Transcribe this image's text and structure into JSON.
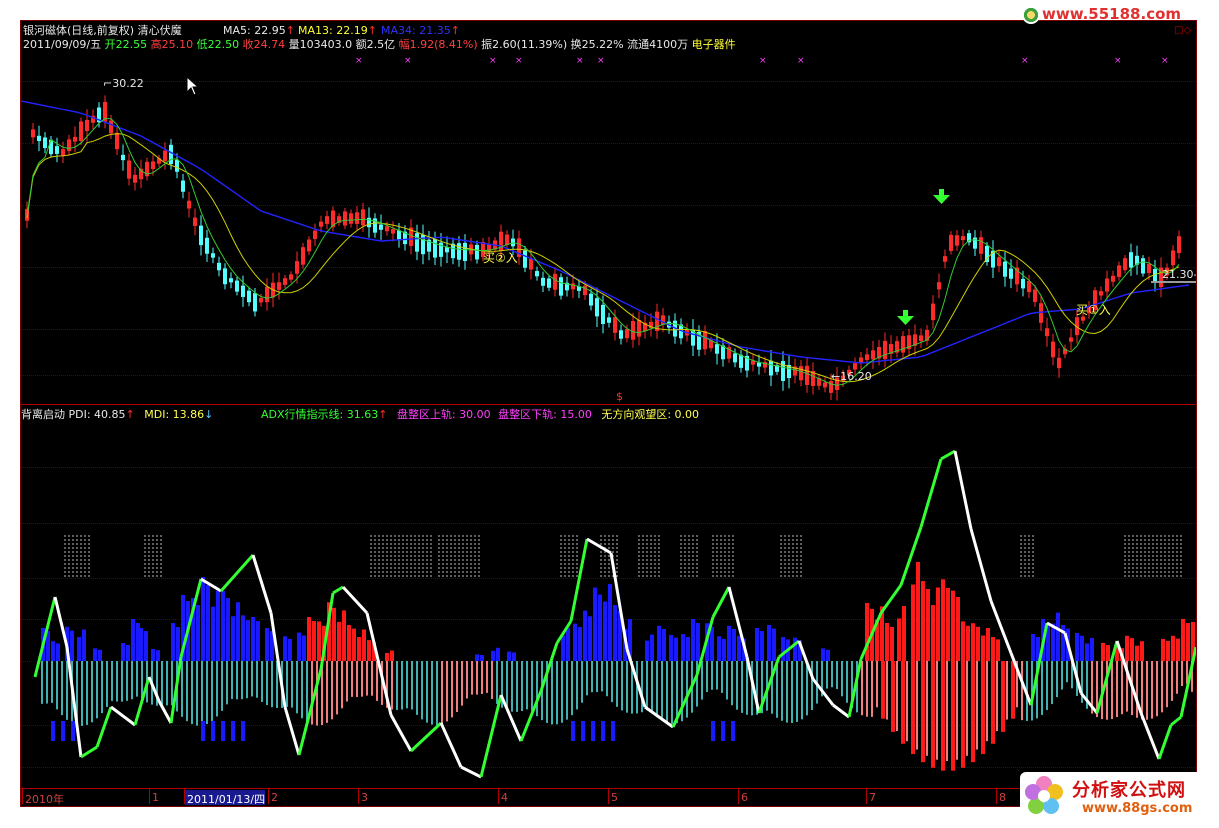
{
  "header": {
    "stock_name": "银河磁体(日线,前复权)",
    "formula_name": "清心伏魔",
    "ma5": "MA5: 22.95",
    "ma13": "MA13: 22.19",
    "ma34": "MA34: 21.35",
    "arrow_up": "↑",
    "arrow_down": "↓",
    "date": "2011/09/09/五",
    "open_label": "开",
    "open": "22.55",
    "high_label": "高",
    "high": "25.10",
    "low_label": "低",
    "low": "22.50",
    "close_label": "收",
    "close": "24.74",
    "volume": "量103403.0",
    "amount": "额2.5亿",
    "change_label": "幅",
    "change": "1.92(8.41%)",
    "amplitude": "振2.60(11.39%)",
    "turnover": "换25.22%",
    "float": "流通4100万",
    "sector": "电子器件"
  },
  "price_panel": {
    "high_mark": "30.22",
    "low_mark": "←16.20",
    "last_mark": "21.30-",
    "buy1": "买①入",
    "buy2": "买②入",
    "divider_mark": "$"
  },
  "indicator": {
    "name": "背离启动",
    "pdi": "PDI: 40.85",
    "mdi": "MDI: 13.86",
    "adx": "ADX行情指示线: 31.63",
    "upper": "盘整区上轨: 30.00",
    "lower": "盘整区下轨: 15.00",
    "nodir": "无方向观望区: 0.00"
  },
  "time_axis": {
    "labels": [
      "2010年",
      "1",
      "2011/01/13/四",
      "2",
      "3",
      "4",
      "5",
      "6",
      "7",
      "8"
    ]
  },
  "watermarks": {
    "site1": "www.55188.com",
    "site2_cn": "分析家公式网",
    "site2_url": "www.88gs.com"
  },
  "colors": {
    "background": "#000000",
    "up_candle": "#ff2a2a",
    "down_candle": "#54ffff",
    "ma5": "#ffffff",
    "ma13": "#ffff00",
    "ma34": "#2323ff",
    "pdi": "#ff2020",
    "mdi": "#2020ff",
    "adx_up": "#33ff33",
    "adx_down": "#ffffff"
  },
  "chart_data": {
    "type": "candlestick",
    "price_marks": {
      "high": 30.22,
      "low": 16.2,
      "last": 21.3
    },
    "indicator_values": {
      "PDI": 40.85,
      "MDI": 13.86,
      "ADX": 31.63,
      "upper": 30.0,
      "lower": 15.0,
      "nodir": 0.0
    }
  }
}
